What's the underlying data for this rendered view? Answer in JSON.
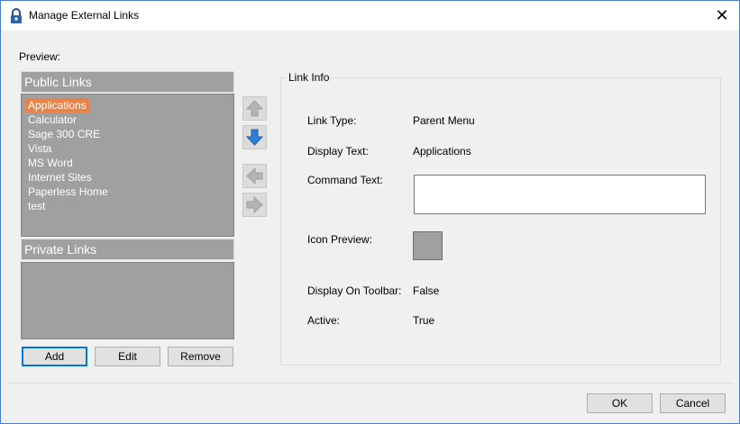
{
  "window": {
    "title": "Manage External Links",
    "close_glyph": "✕"
  },
  "preview_label": "Preview:",
  "public_links": {
    "header": "Public Links",
    "items": [
      "Applications",
      "Calculator",
      "Sage 300 CRE",
      "Vista",
      "MS Word",
      "Internet Sites",
      "Paperless Home",
      "test"
    ],
    "selected_index": 0
  },
  "private_links": {
    "header": "Private Links",
    "items": []
  },
  "buttons": {
    "add": "Add",
    "edit": "Edit",
    "remove": "Remove",
    "ok": "OK",
    "cancel": "Cancel"
  },
  "link_info": {
    "title": "Link Info",
    "link_type_label": "Link Type:",
    "link_type_value": "Parent Menu",
    "display_text_label": "Display Text:",
    "display_text_value": "Applications",
    "command_text_label": "Command Text:",
    "command_text_value": "",
    "icon_preview_label": "Icon Preview:",
    "display_on_toolbar_label": "Display On Toolbar:",
    "display_on_toolbar_value": "False",
    "active_label": "Active:",
    "active_value": "True"
  },
  "colors": {
    "selection": "#e8834a",
    "list_bg": "#a0a0a0",
    "arrow_down_active": "#2f7fd6",
    "arrow_disabled": "#b4b4b4",
    "title_border": "#4a7ec8"
  },
  "icons": {
    "title": "lock-icon",
    "move_up": "arrow-up-icon",
    "move_down": "arrow-down-icon",
    "move_left": "arrow-left-icon",
    "move_right": "arrow-right-icon"
  }
}
